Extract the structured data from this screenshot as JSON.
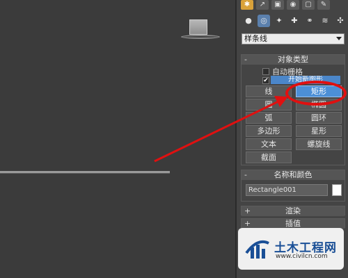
{
  "command_panel": {
    "tabs": [
      "✱",
      "↗",
      "▣",
      "◉",
      "▢",
      "✎"
    ],
    "subtabs": [
      "●",
      "◎",
      "✦",
      "✚",
      "⚭",
      "≋",
      "✣"
    ],
    "category_dropdown": {
      "value": "样条线"
    }
  },
  "object_type": {
    "title": "对象类型",
    "toggle": "-",
    "auto_grid_label": "自动栅格",
    "start_new_shape_label": "开始新图形",
    "start_new_checked": "✔",
    "buttons": [
      {
        "label": "线"
      },
      {
        "label": "矩形",
        "selected": true
      },
      {
        "label": "圆"
      },
      {
        "label": "椭圆"
      },
      {
        "label": "弧"
      },
      {
        "label": "圆环"
      },
      {
        "label": "多边形"
      },
      {
        "label": "星形"
      },
      {
        "label": "文本"
      },
      {
        "label": "螺旋线"
      },
      {
        "label": "截面"
      }
    ]
  },
  "name_and_color": {
    "title": "名称和颜色",
    "toggle": "-",
    "name_value": "Rectangle001",
    "color": "#ffffff"
  },
  "rendering": {
    "title": "渲染",
    "toggle": "+"
  },
  "interpolation": {
    "title": "插值",
    "toggle": "+"
  },
  "watermark": {
    "title": "土木工程网",
    "url": "www.civilcn.com"
  },
  "colors": {
    "highlight": "#e01010",
    "selected_button": "#4c8fd6",
    "active_tab": "#d9a23a"
  }
}
